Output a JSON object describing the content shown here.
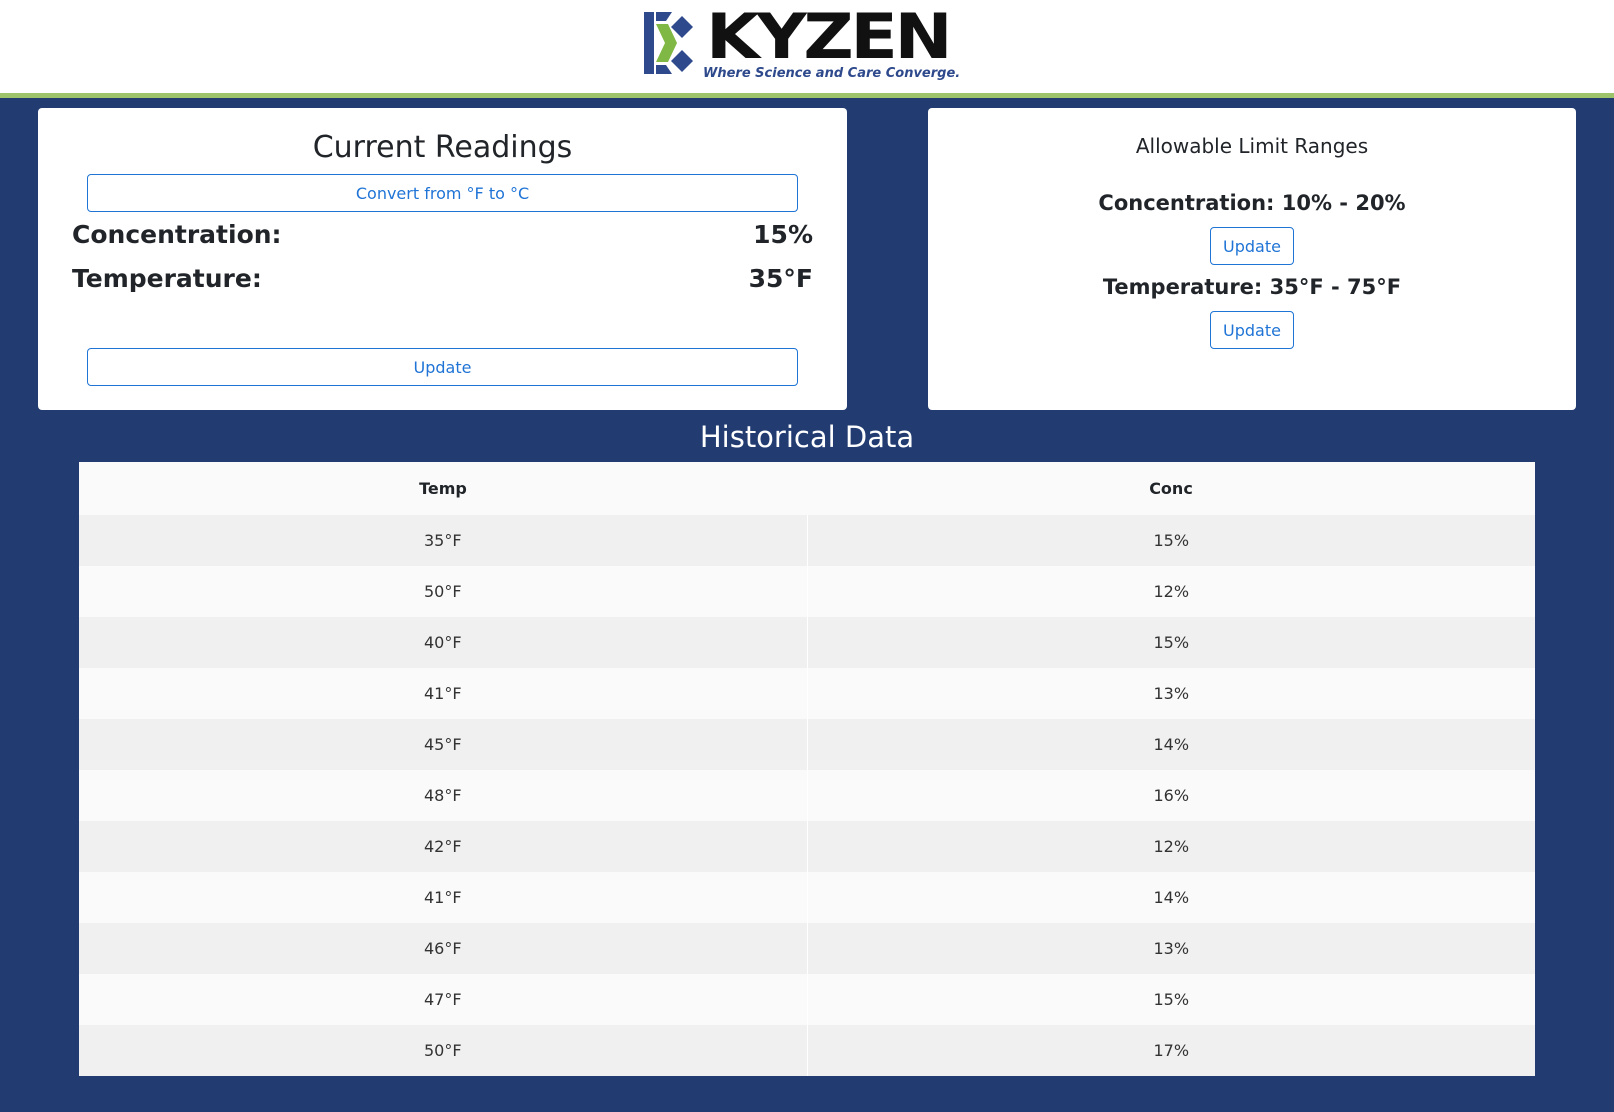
{
  "brand": {
    "name": "KYZEN",
    "tagline": "Where Science and Care Converge."
  },
  "colors": {
    "background": "#223c72",
    "accent_stripe": "#9dc36b",
    "button_blue": "#1f74d6"
  },
  "current_readings": {
    "title": "Current Readings",
    "convert_button": "Convert from °F to °C",
    "concentration_label": "Concentration:",
    "concentration_value": "15%",
    "temperature_label": "Temperature:",
    "temperature_value": "35°F",
    "update_button": "Update"
  },
  "limits": {
    "title": "Allowable Limit Ranges",
    "concentration": "Concentration: 10% - 20%",
    "concentration_update": "Update",
    "temperature": "Temperature: 35°F - 75°F",
    "temperature_update": "Update"
  },
  "history": {
    "title": "Historical Data",
    "columns": [
      "Temp",
      "Conc"
    ],
    "rows": [
      [
        "35°F",
        "15%"
      ],
      [
        "50°F",
        "12%"
      ],
      [
        "40°F",
        "15%"
      ],
      [
        "41°F",
        "13%"
      ],
      [
        "45°F",
        "14%"
      ],
      [
        "48°F",
        "16%"
      ],
      [
        "42°F",
        "12%"
      ],
      [
        "41°F",
        "14%"
      ],
      [
        "46°F",
        "13%"
      ],
      [
        "47°F",
        "15%"
      ],
      [
        "50°F",
        "17%"
      ]
    ]
  }
}
